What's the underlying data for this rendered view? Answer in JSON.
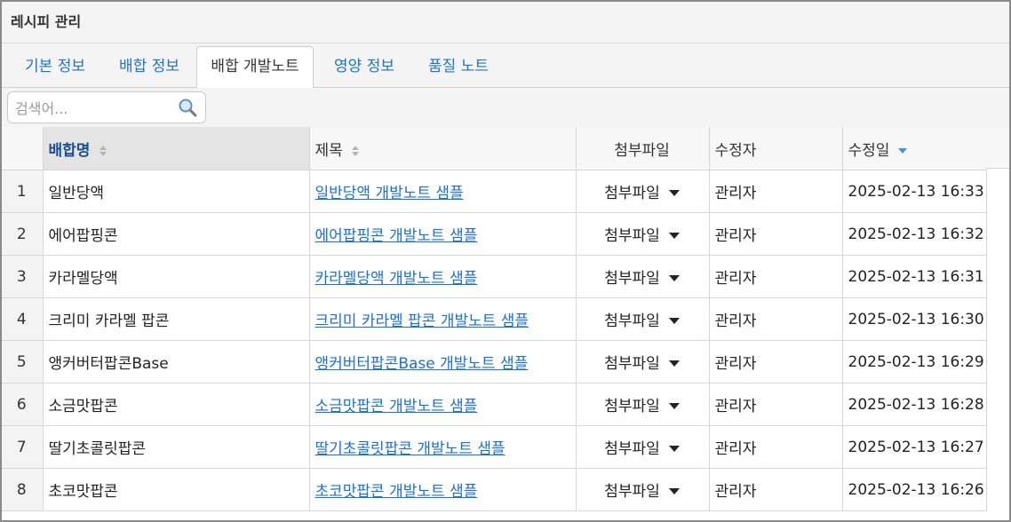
{
  "window": {
    "title": "레시피 관리"
  },
  "tabs": [
    {
      "label": "기본 정보"
    },
    {
      "label": "배합 정보"
    },
    {
      "label": "배합 개발노트"
    },
    {
      "label": "영양 정보"
    },
    {
      "label": "품질 노트"
    }
  ],
  "active_tab": "배합 개발노트",
  "search": {
    "placeholder": "검색어...",
    "value": ""
  },
  "columns": {
    "name": "배합명",
    "title": "제목",
    "attachment": "첨부파일",
    "editor": "수정자",
    "modified": "수정일"
  },
  "sort": {
    "column": "수정일",
    "direction": "desc"
  },
  "rows": [
    {
      "no": "1",
      "name": "일반당액",
      "title": "일반당액 개발노트 샘플",
      "attachment": "첨부파일",
      "editor": "관리자",
      "modified": "2025-02-13 16:33"
    },
    {
      "no": "2",
      "name": "에어팝핑콘",
      "title": "에어팝핑콘 개발노트 샘플",
      "attachment": "첨부파일",
      "editor": "관리자",
      "modified": "2025-02-13 16:32"
    },
    {
      "no": "3",
      "name": "카라멜당액",
      "title": "카라멜당액 개발노트 샘플",
      "attachment": "첨부파일",
      "editor": "관리자",
      "modified": "2025-02-13 16:31"
    },
    {
      "no": "4",
      "name": "크리미 카라멜 팝콘",
      "title": "크리미 카라멜 팝콘 개발노트 샘플",
      "attachment": "첨부파일",
      "editor": "관리자",
      "modified": "2025-02-13 16:30"
    },
    {
      "no": "5",
      "name": "앵커버터팝콘Base",
      "title": "앵커버터팝콘Base 개발노트 샘플",
      "attachment": "첨부파일",
      "editor": "관리자",
      "modified": "2025-02-13 16:29"
    },
    {
      "no": "6",
      "name": "소금맛팝콘",
      "title": "소금맛팝콘 개발노트 샘플",
      "attachment": "첨부파일",
      "editor": "관리자",
      "modified": "2025-02-13 16:28"
    },
    {
      "no": "7",
      "name": "딸기초콜릿팝콘",
      "title": "딸기초콜릿팝콘 개발노트 샘플",
      "attachment": "첨부파일",
      "editor": "관리자",
      "modified": "2025-02-13 16:27"
    },
    {
      "no": "8",
      "name": "초코맛팝콘",
      "title": "초코맛팝콘 개발노트 샘플",
      "attachment": "첨부파일",
      "editor": "관리자",
      "modified": "2025-02-13 16:26"
    }
  ],
  "colors": {
    "link": "#1f6fd1",
    "tab": "#1f73c7",
    "sort_active": "#4a90d9"
  },
  "icons": {
    "search": "search-icon",
    "sort": "sort-icon",
    "dropdown": "caret-down-icon"
  }
}
